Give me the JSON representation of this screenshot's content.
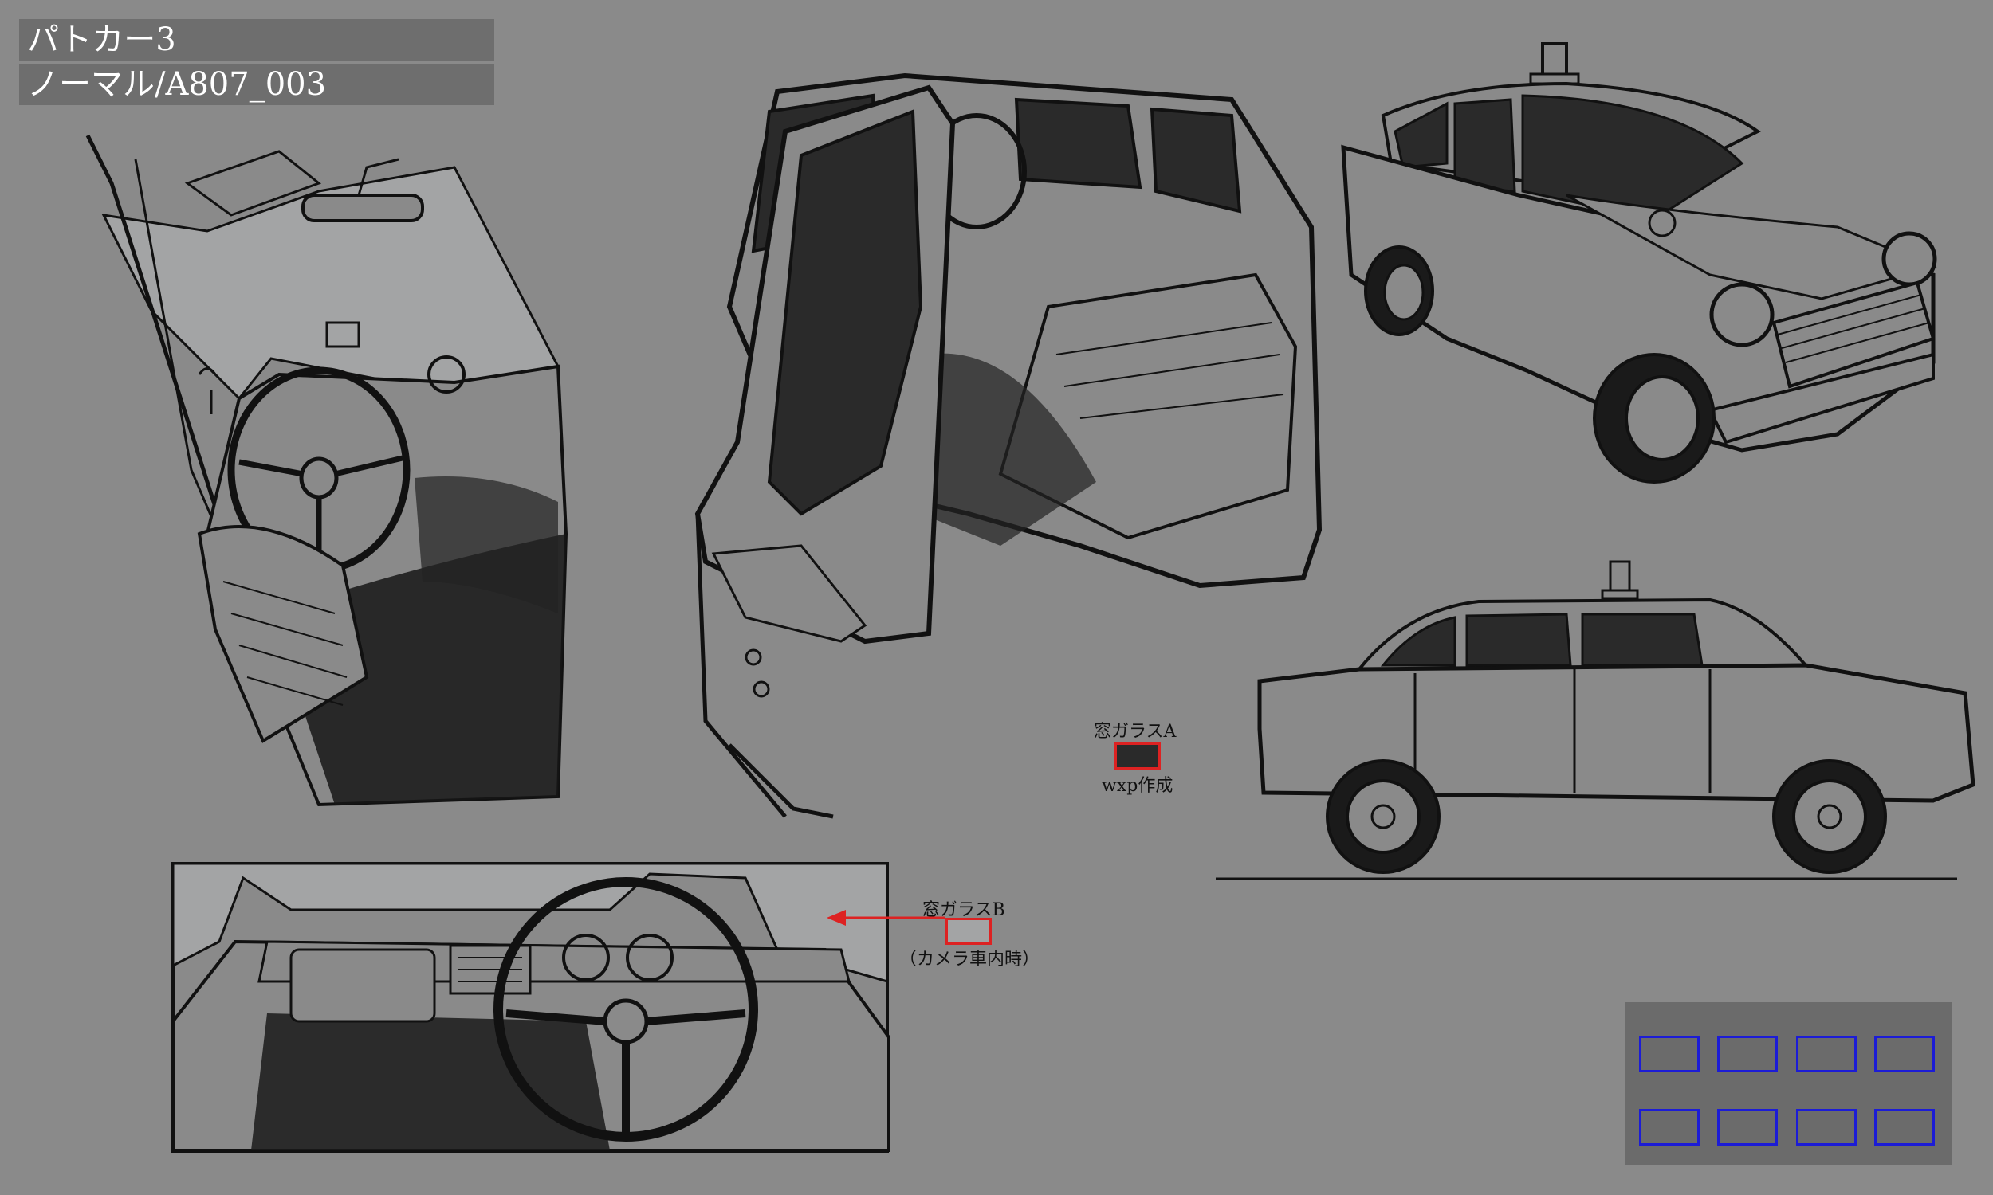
{
  "header": {
    "title_line1": "パトカー3",
    "title_line2": "ノーマル/A807_003"
  },
  "glass_a": {
    "name": "窓ガラスA",
    "note": "wxp作成",
    "color": "#2a2a2a",
    "border_color": "#dd2222"
  },
  "glass_b": {
    "name": "窓ガラスB",
    "note": "（カメラ車内時）",
    "color": "#a3a4a5",
    "border_color": "#dd2222"
  },
  "views": [
    {
      "name": "interior-driver-seat-view"
    },
    {
      "name": "open-door-view"
    },
    {
      "name": "front-three-quarter-view"
    },
    {
      "name": "side-view"
    },
    {
      "name": "dashboard-view"
    }
  ],
  "palette_panel": {
    "slot_count": 8,
    "slot_border": "#1c1cd6"
  },
  "colors": {
    "background": "#8a8a8a",
    "title_box": "#6e6e6e",
    "window_dark": "#2a2a2a",
    "window_light": "#a3a4a5",
    "ink": "#111111"
  }
}
